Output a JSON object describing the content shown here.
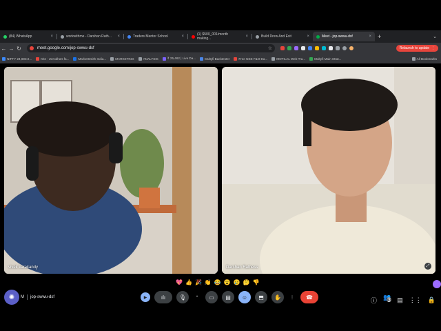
{
  "tabs": [
    {
      "label": "(84) WhatsApp",
      "color": "#25d366",
      "active": false
    },
    {
      "label": "workwithme - Darshan Rath...",
      "color": "#9aa0a6",
      "active": false
    },
    {
      "label": "Traders Mentor School",
      "color": "#4285f4",
      "active": false
    },
    {
      "label": "(1) $500_001/month making...",
      "color": "#ff0000",
      "active": false
    },
    {
      "label": "Build Drew And Exit",
      "color": "#9aa0a6",
      "active": false
    },
    {
      "label": "Meet - jop-swwu-dsf",
      "color": "#00ac47",
      "active": true
    }
  ],
  "new_tab_icon": "plus-icon",
  "tab_menu_icon": "chevron-down-icon",
  "url": "meet.google.com/jop-swwu-dsf",
  "relaunch_label": "Relaunch to update",
  "bookmarks": [
    {
      "label": "NIFTY  24,693.0...",
      "color": "#3c8bff"
    },
    {
      "label": "Kite - Zerodha's fa...",
      "color": "#e8453c"
    },
    {
      "label": "MarketSmith India...",
      "color": "#1a73e8"
    },
    {
      "label": "MARKETING",
      "color": "#9aa0a6"
    },
    {
      "label": "ANALYSIS",
      "color": "#9aa0a6"
    },
    {
      "label": "₹ 25,462 | Live Da...",
      "color": "#7b61ff"
    },
    {
      "label": "Multyfi Backtester",
      "color": "#4a86e8"
    },
    {
      "label": "Free NSE F&O Da...",
      "color": "#e8453c"
    },
    {
      "label": "MOTILAL Web Tra...",
      "color": "#9aa0a6"
    },
    {
      "label": "Multyfi Main Strat...",
      "color": "#34a853"
    }
  ],
  "all_bookmarks_label": "All Bookmarks",
  "participants": [
    {
      "name": "vivek karakandy"
    },
    {
      "name": "Darshan Rathess"
    }
  ],
  "reactions": [
    "💖",
    "👍",
    "🎉",
    "👏",
    "😂",
    "😮",
    "😢",
    "🤔",
    "👎"
  ],
  "meeting": {
    "time": "M",
    "code": "jop-swwu-dsf"
  },
  "controls": {
    "present_badge": "▶",
    "participants_count": "3"
  },
  "colors": {
    "end_call": "#ea4335",
    "active_control": "#8ab4f8",
    "brand": "#5b5fc7"
  }
}
